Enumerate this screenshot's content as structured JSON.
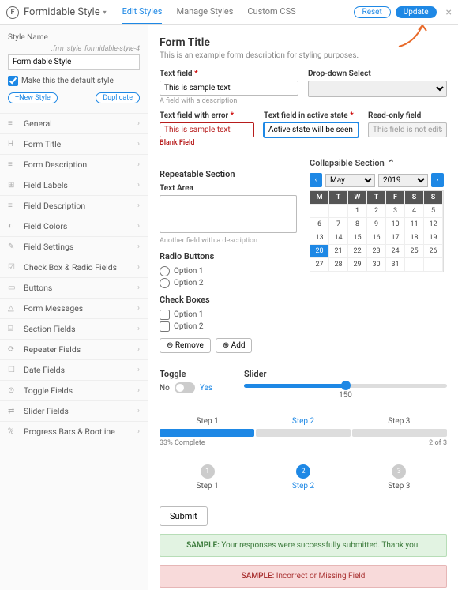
{
  "header": {
    "appname": "Formidable Style",
    "tabs": [
      "Edit Styles",
      "Manage Styles",
      "Custom CSS"
    ],
    "active_tab": 0,
    "reset": "Reset",
    "update": "Update"
  },
  "sidebar": {
    "style_name_label": "Style Name",
    "style_class": ".frm_style_formidable-style-4",
    "style_name_value": "Formidable Style",
    "default_label": "Make this the default style",
    "newstyle": "+New Style",
    "duplicate": "Duplicate",
    "items": [
      {
        "icon": "≡",
        "label": "General"
      },
      {
        "icon": "H",
        "label": "Form Title"
      },
      {
        "icon": "≡",
        "label": "Form Description"
      },
      {
        "icon": "⊞",
        "label": "Field Labels"
      },
      {
        "icon": "≡",
        "label": "Field Description"
      },
      {
        "icon": "◐",
        "label": "Field Colors"
      },
      {
        "icon": "✎",
        "label": "Field Settings"
      },
      {
        "icon": "☑",
        "label": "Check Box & Radio Fields"
      },
      {
        "icon": "▭",
        "label": "Buttons"
      },
      {
        "icon": "△",
        "label": "Form Messages"
      },
      {
        "icon": "⌸",
        "label": "Section Fields"
      },
      {
        "icon": "⟳",
        "label": "Repeater Fields"
      },
      {
        "icon": "☐",
        "label": "Date Fields"
      },
      {
        "icon": "⊙",
        "label": "Toggle Fields"
      },
      {
        "icon": "⇄",
        "label": "Slider Fields"
      },
      {
        "icon": "%",
        "label": "Progress Bars & Rootline"
      }
    ]
  },
  "form": {
    "title": "Form Title",
    "desc": "This is an example form description for styling purposes.",
    "textfield_label": "Text field",
    "textfield_value": "This is sample text",
    "textfield_hint": "A field with a description",
    "dropdown_label": "Drop-down Select",
    "err_label": "Text field with error",
    "err_value": "This is sample text",
    "err_hint": "Blank Field",
    "active_label": "Text field in active state",
    "active_value": "Active state will be seen here",
    "ro_label": "Read-only field",
    "ro_value": "This field is not editable",
    "repeat_section": "Repeatable Section",
    "textarea_label": "Text Area",
    "textarea_hint": "Another field with a description",
    "radio_label": "Radio Buttons",
    "radio_options": [
      "Option 1",
      "Option 2"
    ],
    "chk_label": "Check Boxes",
    "chk_options": [
      "Option 1",
      "Option 2"
    ],
    "remove": "⊖ Remove",
    "add": "⊕ Add",
    "collapse_label": "Collapsible Section",
    "calendar": {
      "month": "May",
      "year": "2019",
      "dow": [
        "M",
        "T",
        "W",
        "T",
        "F",
        "S",
        "S"
      ],
      "rows": [
        [
          "",
          "",
          "1",
          "2",
          "3",
          "4",
          "5"
        ],
        [
          "6",
          "7",
          "8",
          "9",
          "10",
          "11",
          "12"
        ],
        [
          "13",
          "14",
          "15",
          "16",
          "17",
          "18",
          "19"
        ],
        [
          "20",
          "21",
          "22",
          "23",
          "24",
          "25",
          "26"
        ],
        [
          "27",
          "28",
          "29",
          "30",
          "31",
          "",
          ""
        ]
      ],
      "selected": "20"
    },
    "toggle_label": "Toggle",
    "toggle_no": "No",
    "toggle_yes": "Yes",
    "slider_label": "Slider",
    "slider_value": "150",
    "steps": [
      "Step 1",
      "Step 2",
      "Step 3"
    ],
    "progress_pct": "33% Complete",
    "progress_of": "2 of 3",
    "submit": "Submit",
    "success_prefix": "SAMPLE:",
    "success_msg": " Your responses were successfully submitted. Thank you!",
    "error_prefix": "SAMPLE:",
    "error_msg": " Incorrect or Missing Field"
  }
}
